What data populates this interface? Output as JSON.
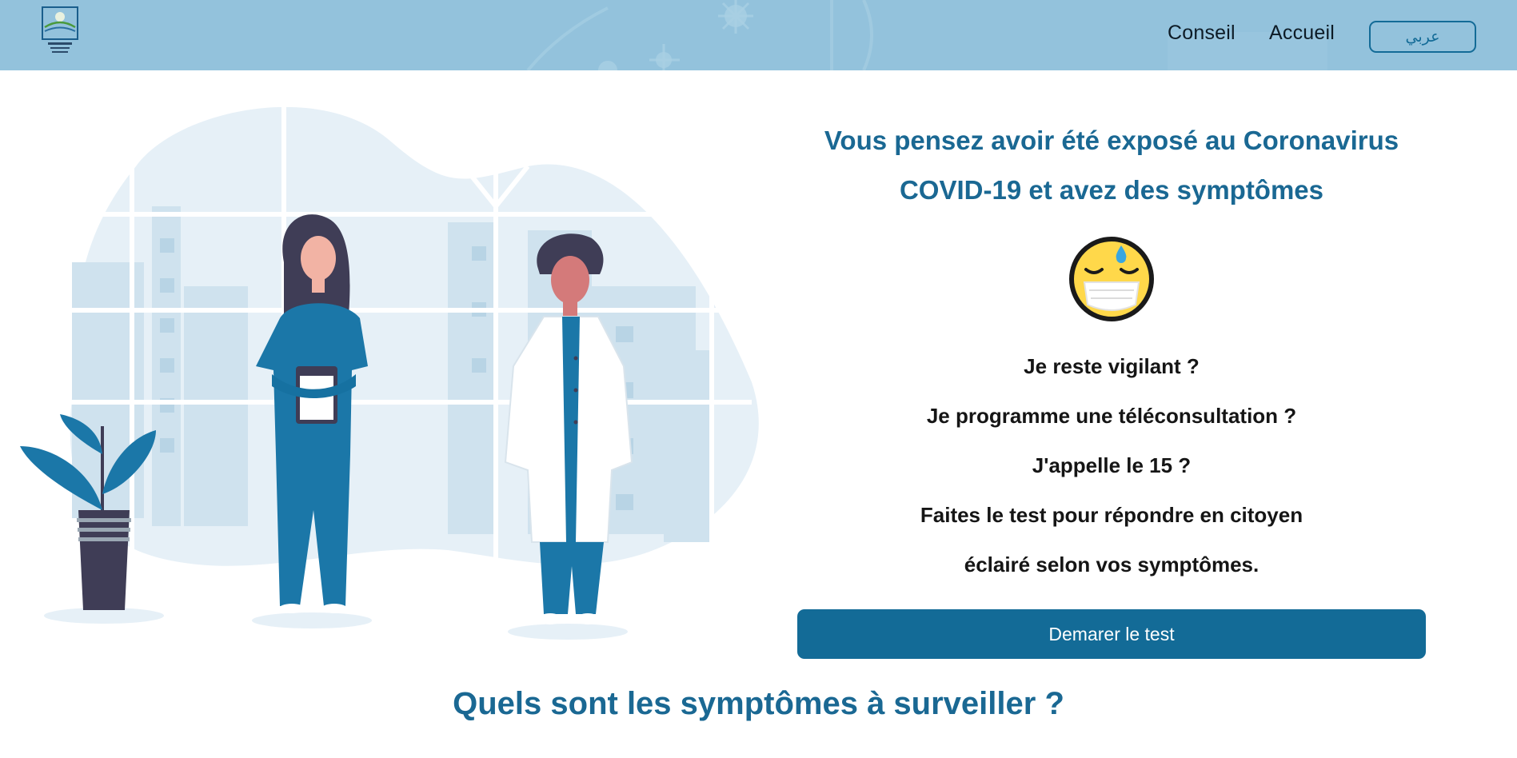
{
  "nav": {
    "conseil_label": "Conseil",
    "accueil_label": "Accueil",
    "language_label": "عربي"
  },
  "hero": {
    "heading": "Vous pensez avoir été exposé au Coronavirus COVID-19 et avez des symptômes",
    "lines": [
      "Je reste vigilant ?",
      "Je programme une téléconsultation ?",
      "J'appelle le 15 ?",
      "Faites le test pour répondre en citoyen",
      "éclairé selon vos symptômes."
    ],
    "cta_label": "Demarer le test",
    "emoji": "masked-sweating-face-icon"
  },
  "symptoms": {
    "title": "Quels sont les symptômes à surveiller ?"
  },
  "colors": {
    "header_bg": "#93c2dc",
    "primary": "#136b97",
    "heading_text": "#1a6893"
  }
}
